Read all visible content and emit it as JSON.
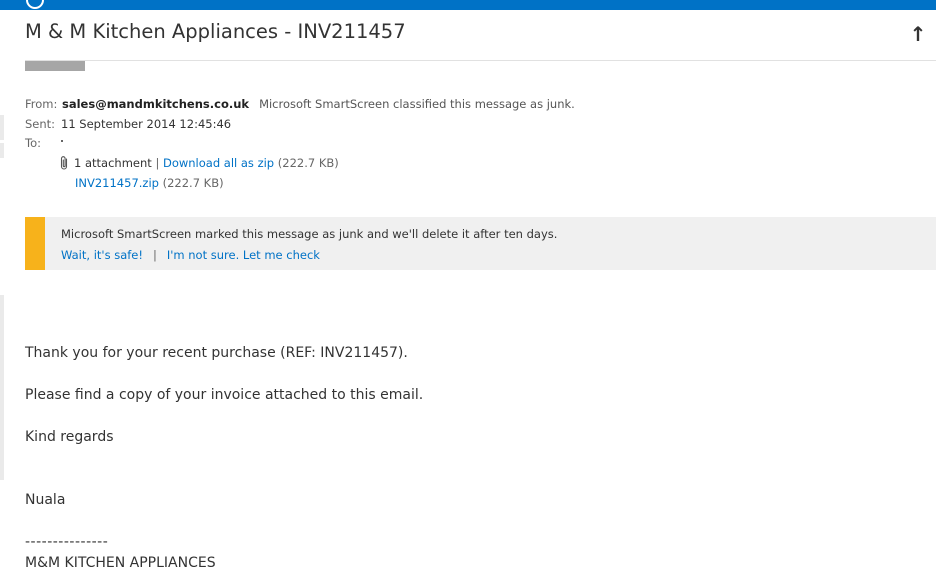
{
  "message": {
    "subject": "M & M Kitchen Appliances - INV211457",
    "from_label": "From:",
    "from_value": "sales@mandmkitchens.co.uk",
    "junk_classified_note": "Microsoft SmartScreen classified this message as junk.",
    "sent_label": "Sent:",
    "sent_value": "11 September 2014 12:45:46",
    "to_label": "To:",
    "to_value": "."
  },
  "attachments": {
    "count_text": "1 attachment",
    "separator": "|",
    "download_all": "Download all as zip",
    "download_size": "(222.7 KB)",
    "file_name": "INV211457.zip",
    "file_size": "(222.7 KB)"
  },
  "junk_banner": {
    "text": "Microsoft SmartScreen marked this message as junk and we'll delete it after ten days.",
    "safe_link": "Wait, it's safe!",
    "separator": "|",
    "unsure_link": "I'm not sure. Let me check",
    "accent_color": "#f7b21b"
  },
  "body": {
    "line1": "Thank you for your recent purchase (REF: INV211457).",
    "line2": "Please find a copy of your invoice attached to this email.",
    "line3": "Kind regards",
    "line4": "Nuala",
    "line5": "---------------",
    "line6": "M&M KITCHEN APPLIANCES"
  },
  "icons": {
    "reply_collapse": "up-arrow-icon",
    "attachment": "paperclip-icon"
  },
  "colors": {
    "brand_bar": "#0072c6",
    "link": "#0072c6"
  }
}
